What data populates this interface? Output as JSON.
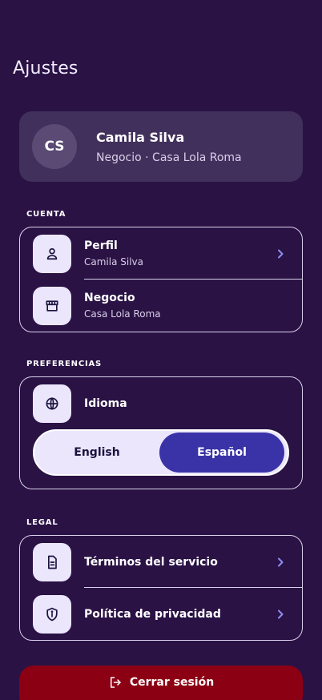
{
  "header": {
    "title": "Ajustes"
  },
  "profile": {
    "initials": "CS",
    "name": "Camila Silva",
    "subtitle": "Negocio · Casa Lola Roma"
  },
  "sections": {
    "account": {
      "label": "CUENTA",
      "items": [
        {
          "title": "Perfil",
          "subtitle": "Camila Silva",
          "icon": "user-icon"
        },
        {
          "title": "Negocio",
          "subtitle": "Casa Lola Roma",
          "icon": "store-icon"
        }
      ]
    },
    "preferences": {
      "label": "PREFERENCIAS",
      "language": {
        "title": "Idioma",
        "icon": "globe-icon",
        "options": [
          "English",
          "Español"
        ],
        "selected": "Español"
      }
    },
    "legal": {
      "label": "LEGAL",
      "items": [
        {
          "title": "Términos del servicio",
          "icon": "document-icon"
        },
        {
          "title": "Política de privacidad",
          "icon": "shield-icon"
        }
      ]
    }
  },
  "logout": {
    "label": "Cerrar sesión",
    "icon": "logout-icon"
  },
  "colors": {
    "background": "#2a1245",
    "card": "#41305c",
    "accent": "#3a33a8",
    "icon_bg": "#ebe6fb",
    "danger": "#8c0014"
  }
}
